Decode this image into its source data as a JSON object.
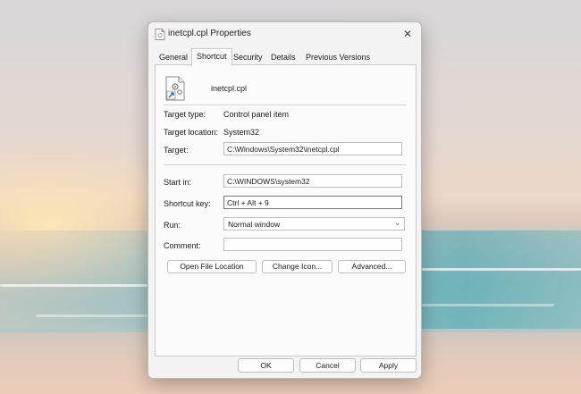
{
  "window": {
    "title": "inetcpl.cpl Properties",
    "close_glyph": "✕"
  },
  "tabs": [
    {
      "label": "General",
      "active": false
    },
    {
      "label": "Shortcut",
      "active": true
    },
    {
      "label": "Security",
      "active": false
    },
    {
      "label": "Details",
      "active": false
    },
    {
      "label": "Previous Versions",
      "active": false
    }
  ],
  "shortcut": {
    "file_name": "inetcpl.cpl",
    "file_icon": "shortcut-file-icon",
    "target_type_label": "Target type:",
    "target_type_value": "Control panel item",
    "target_location_label": "Target location:",
    "target_location_value": "System32",
    "target_label": "Target:",
    "target_value": "C:\\Windows\\System32\\inetcpl.cpl",
    "start_in_label": "Start in:",
    "start_in_value": "C:\\WINDOWS\\system32",
    "shortcut_key_label": "Shortcut key:",
    "shortcut_key_value": "Ctrl + Alt + 9",
    "run_label": "Run:",
    "run_value": "Normal window",
    "comment_label": "Comment:",
    "comment_value": "",
    "open_file_location_label": "Open File Location",
    "change_icon_label": "Change Icon...",
    "advanced_label": "Advanced..."
  },
  "footer": {
    "ok_label": "OK",
    "cancel_label": "Cancel",
    "apply_label": "Apply"
  },
  "colors": {
    "dialog_bg": "#f3f3f3",
    "panel_bg": "#fbfbfb",
    "border": "#bdbdbd",
    "link_arrow": "#1f5fbf"
  }
}
